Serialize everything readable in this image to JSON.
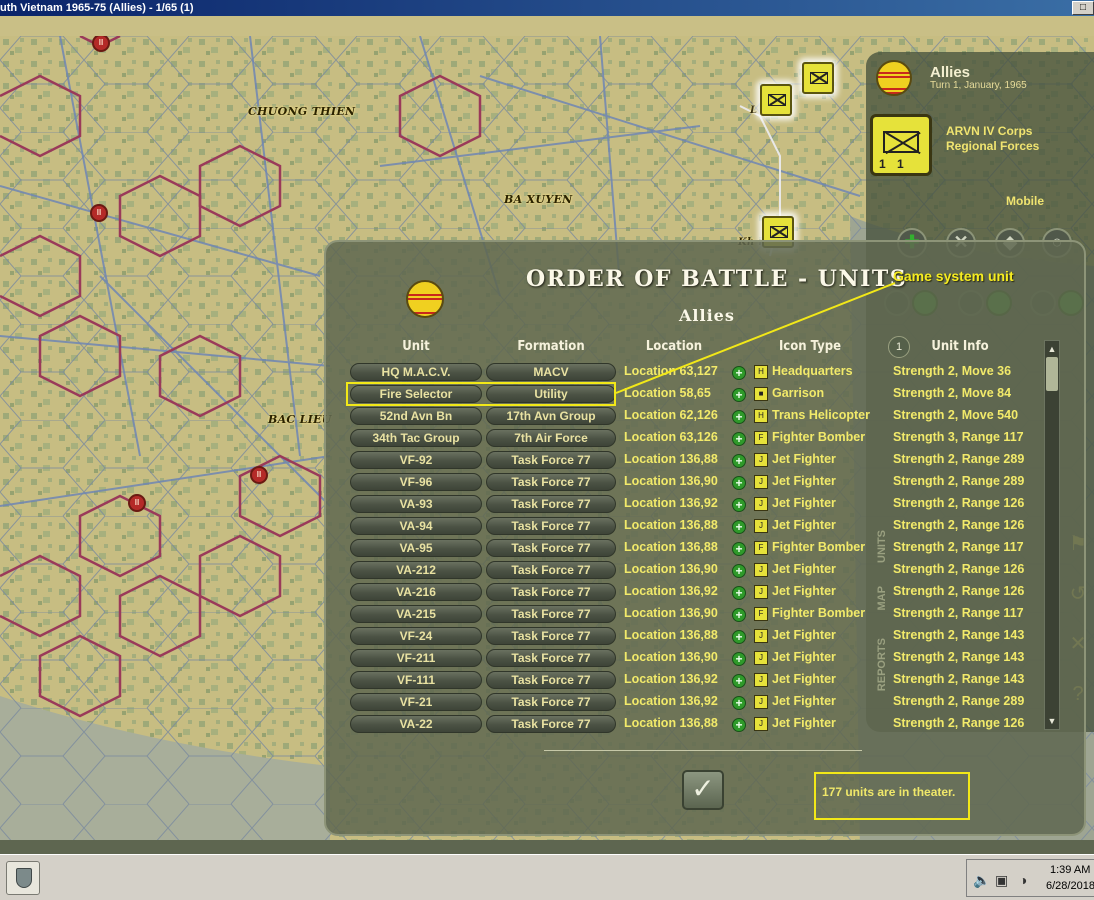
{
  "window": {
    "title": "uth Vietnam  1965-75 (Allies) - 1/65 (1)",
    "close_glyph": "□"
  },
  "map": {
    "labels": [
      {
        "text": "CHUONG THIEN"
      },
      {
        "text": "BA XUYEN"
      },
      {
        "text": "BAC LIEU"
      }
    ],
    "partial_labels": {
      "top": "L     h",
      "mid": "Kh      ng"
    },
    "city_glyph": "II"
  },
  "side_panel": {
    "side": "Allies",
    "turn_text": "Turn 1, January, 1965",
    "unit_name_line1": "ARVN IV Corps",
    "unit_name_line2": "Regional Forces",
    "unit_strength_digits": "11",
    "status": "Mobile",
    "actions": [
      {
        "name": "add-action",
        "glyph": "✚"
      },
      {
        "name": "cancel-action",
        "glyph": "✕"
      },
      {
        "name": "defend-action",
        "glyph": "◆"
      },
      {
        "name": "cycle-action",
        "glyph": "○"
      }
    ],
    "right_buttons": [
      {
        "glyph": "⚑"
      },
      {
        "glyph": "↺"
      },
      {
        "glyph": "✕"
      },
      {
        "glyph": "?"
      }
    ]
  },
  "oob": {
    "title": "ORDER OF BATTLE - UNITS",
    "subtitle": "Allies",
    "page_number": "1",
    "columns": {
      "unit": "Unit",
      "formation": "Formation",
      "location": "Location",
      "icon_type": "Icon Type",
      "unit_info": "Unit Info"
    },
    "rows": [
      {
        "unit": "HQ M.A.C.V.",
        "formation": "MACV",
        "location": "Location 63,127",
        "type": "Headquarters",
        "icon": "H",
        "info": "Strength 2, Move 36"
      },
      {
        "unit": "Fire Selector",
        "formation": "Utility",
        "location": "Location 58,65",
        "type": "Garrison",
        "icon": "■",
        "info": "Strength 2, Move 84"
      },
      {
        "unit": "52nd Avn Bn",
        "formation": "17th Avn Group",
        "location": "Location 62,126",
        "type": "Trans Helicopter",
        "icon": "H",
        "info": "Strength 2, Move 540"
      },
      {
        "unit": "34th Tac Group",
        "formation": "7th Air Force",
        "location": "Location 63,126",
        "type": "Fighter Bomber",
        "icon": "F",
        "info": "Strength 3, Range 117"
      },
      {
        "unit": "VF-92",
        "formation": "Task Force 77",
        "location": "Location 136,88",
        "type": "Jet Fighter",
        "icon": "J",
        "info": "Strength 2, Range 289"
      },
      {
        "unit": "VF-96",
        "formation": "Task Force 77",
        "location": "Location 136,90",
        "type": "Jet Fighter",
        "icon": "J",
        "info": "Strength 2, Range 289"
      },
      {
        "unit": "VA-93",
        "formation": "Task Force 77",
        "location": "Location 136,92",
        "type": "Jet Fighter",
        "icon": "J",
        "info": "Strength 2, Range 126"
      },
      {
        "unit": "VA-94",
        "formation": "Task Force 77",
        "location": "Location 136,88",
        "type": "Jet Fighter",
        "icon": "J",
        "info": "Strength 2, Range 126"
      },
      {
        "unit": "VA-95",
        "formation": "Task Force 77",
        "location": "Location 136,88",
        "type": "Fighter Bomber",
        "icon": "F",
        "info": "Strength 2, Range 117"
      },
      {
        "unit": "VA-212",
        "formation": "Task Force 77",
        "location": "Location 136,90",
        "type": "Jet Fighter",
        "icon": "J",
        "info": "Strength 2, Range 126"
      },
      {
        "unit": "VA-216",
        "formation": "Task Force 77",
        "location": "Location 136,92",
        "type": "Jet Fighter",
        "icon": "J",
        "info": "Strength 2, Range 126"
      },
      {
        "unit": "VA-215",
        "formation": "Task Force 77",
        "location": "Location 136,90",
        "type": "Fighter Bomber",
        "icon": "F",
        "info": "Strength 2, Range 117"
      },
      {
        "unit": "VF-24",
        "formation": "Task Force 77",
        "location": "Location 136,88",
        "type": "Jet Fighter",
        "icon": "J",
        "info": "Strength 2, Range 143"
      },
      {
        "unit": "VF-211",
        "formation": "Task Force 77",
        "location": "Location 136,90",
        "type": "Jet Fighter",
        "icon": "J",
        "info": "Strength 2, Range 143"
      },
      {
        "unit": "VF-111",
        "formation": "Task Force 77",
        "location": "Location 136,92",
        "type": "Jet Fighter",
        "icon": "J",
        "info": "Strength 2, Range 143"
      },
      {
        "unit": "VF-21",
        "formation": "Task Force 77",
        "location": "Location 136,92",
        "type": "Jet Fighter",
        "icon": "J",
        "info": "Strength 2, Range 289"
      },
      {
        "unit": "VA-22",
        "formation": "Task Force 77",
        "location": "Location 136,88",
        "type": "Jet Fighter",
        "icon": "J",
        "info": "Strength 2, Range 126"
      }
    ],
    "ok_glyph": "✓",
    "theater_count_text": "177 units are in theater.",
    "side_tabs": [
      "UNITS",
      "MAP",
      "REPORTS"
    ]
  },
  "annotation": {
    "text": "Game system unit"
  },
  "taskbar": {
    "time": "1:39 AM",
    "date": "6/28/2018"
  },
  "colors": {
    "highlight": "#f2e818",
    "text_yellow": "#f2ea6a",
    "panel_bg": "#606850"
  }
}
